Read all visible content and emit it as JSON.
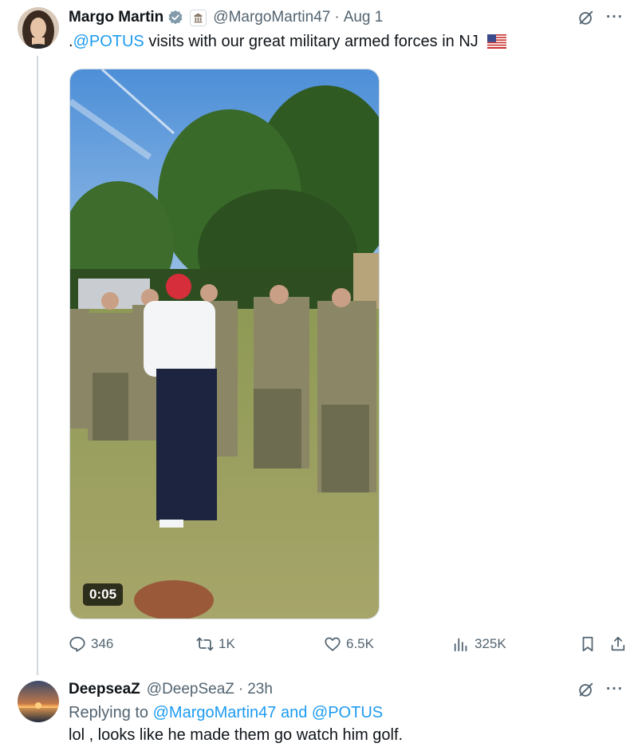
{
  "main_post": {
    "author_name": "Margo Martin",
    "handle": "@MargoMartin47",
    "separator": "·",
    "time": "Aug 1",
    "text_prefix": ".",
    "text_mention": "@POTUS",
    "text_body": " visits with our great military armed forces in NJ",
    "flag_emoji": "us-flag",
    "media": {
      "type": "video",
      "duration": "0:05"
    },
    "more_label": "···",
    "metrics": {
      "replies": "346",
      "reposts": "1K",
      "likes": "6.5K",
      "views": "325K"
    }
  },
  "reply_post": {
    "author_name": "DeepseaZ",
    "handle": "@DeepSeaZ",
    "separator": "·",
    "time": "23h",
    "replying_prefix": "Replying to ",
    "replying_mentions": "@MargoMartin47 and @POTUS",
    "text": "lol , looks like he made them go watch him golf.",
    "more_label": "···"
  },
  "colors": {
    "accent": "#1d9bf0",
    "secondary_text": "#536471",
    "primary_text": "#0f1419",
    "divider": "#cfd9de"
  }
}
